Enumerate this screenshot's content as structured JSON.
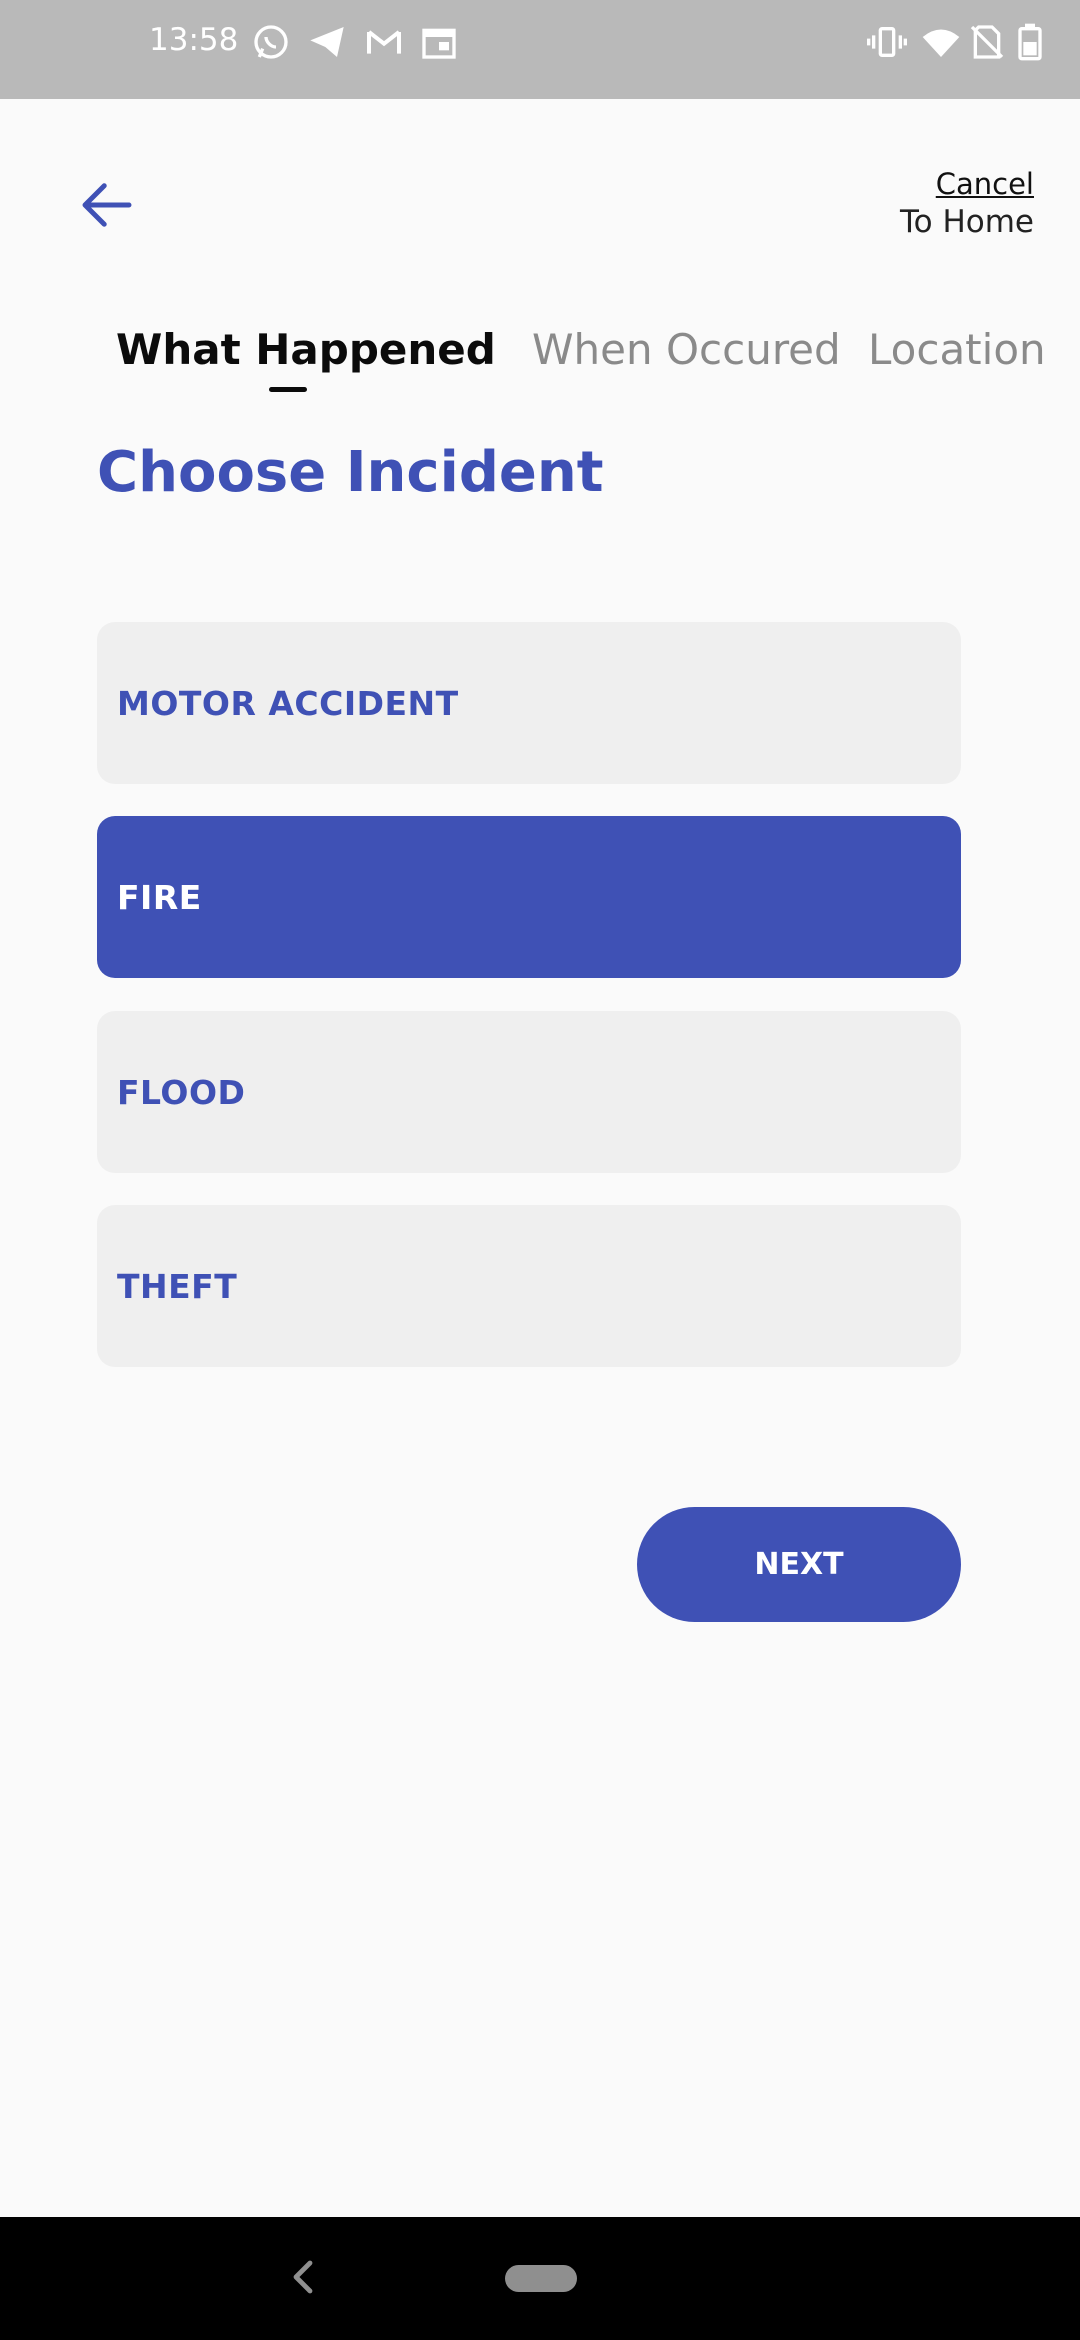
{
  "status_bar": {
    "time": "13:58",
    "left_icons": [
      "whatsapp-icon",
      "telegram-icon",
      "gmail-icon",
      "calendar-icon"
    ],
    "right_icons": [
      "vibrate-icon",
      "wifi-icon",
      "no-sim-icon",
      "battery-icon"
    ]
  },
  "header": {
    "back_icon": "arrow-left-icon",
    "cancel_label": "Cancel",
    "cancel_sub_label": "To Home"
  },
  "tabs": [
    {
      "label": "What Happened",
      "active": true
    },
    {
      "label": "When Occured",
      "active": false
    },
    {
      "label": "Location",
      "active": false
    }
  ],
  "main": {
    "title": "Choose Incident",
    "options": [
      {
        "label": "MOTOR ACCIDENT",
        "selected": false
      },
      {
        "label": "FIRE",
        "selected": true
      },
      {
        "label": "FLOOD",
        "selected": false
      },
      {
        "label": "THEFT",
        "selected": false
      }
    ],
    "next_label": "NEXT"
  },
  "colors": {
    "accent": "#3f51b5",
    "option_bg": "#efefef",
    "status_bar": "#b9b9b9",
    "nav_bar": "#000000"
  }
}
